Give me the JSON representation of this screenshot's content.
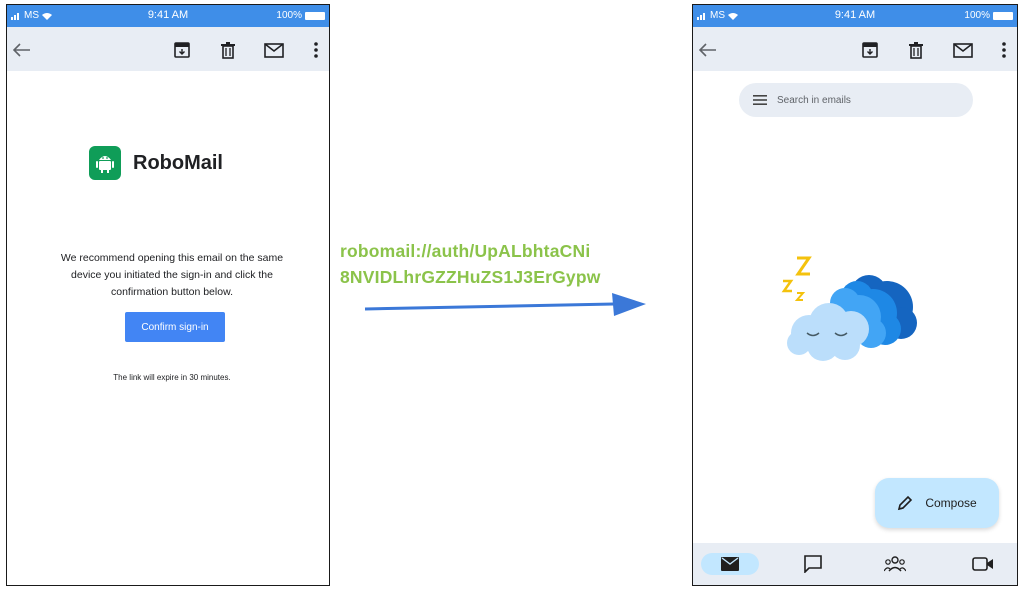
{
  "status_bar": {
    "carrier": "MS",
    "time": "9:41 AM",
    "battery": "100%"
  },
  "left_phone": {
    "brand_name": "RoboMail",
    "message": "We recommend opening this email on the same device you initiated the sign-in and click the confirmation button below.",
    "confirm_button": "Confirm sign-in",
    "expiry_note": "The link will expire in 30 minutes."
  },
  "deep_link": {
    "line1": "robomail://auth/UpALbhtaCNi",
    "line2": "8NVIDLhrGZZHuZS1J3ErGypw"
  },
  "right_phone": {
    "search_placeholder": "Search in emails",
    "compose_label": "Compose"
  },
  "icons": {
    "toolbar": [
      "back-arrow-icon",
      "archive-icon",
      "trash-icon",
      "mail-icon",
      "more-vert-icon"
    ],
    "bottom_nav": [
      "mail-icon",
      "chat-icon",
      "meet-people-icon",
      "video-icon"
    ]
  },
  "colors": {
    "status_bar": "#3f8ee8",
    "toolbar": "#e8edf4",
    "confirm_button": "#4285f4",
    "deep_link": "#8bc34a",
    "arrow": "#3b78d8",
    "logo": "#0f9d58",
    "compose_fab": "#c2e7ff"
  }
}
